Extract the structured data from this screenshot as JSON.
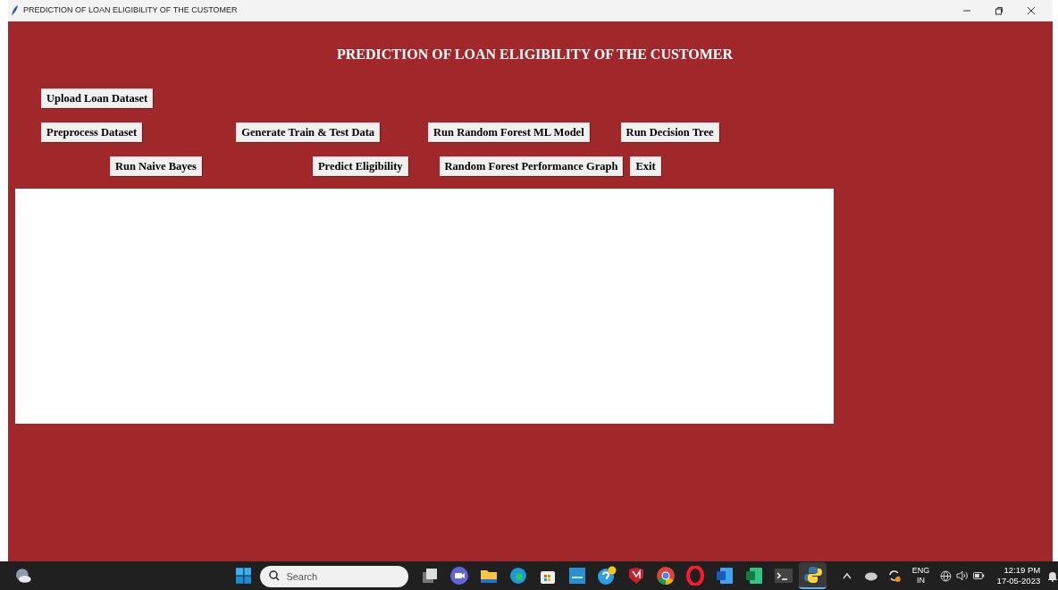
{
  "window": {
    "title": "PREDICTION OF LOAN ELIGIBILITY OF THE CUSTOMER"
  },
  "heading": "PREDICTION OF LOAN ELIGIBILITY OF THE CUSTOMER",
  "button_rows": [
    {
      "buttons": [
        {
          "label": "Upload Loan Dataset"
        }
      ]
    },
    {
      "buttons": [
        {
          "label": "Preprocess Dataset"
        },
        {
          "label": "Generate Train & Test Data"
        },
        {
          "label": "Run Random Forest ML Model"
        },
        {
          "label": "Run Decision Tree"
        }
      ]
    },
    {
      "buttons": [
        {
          "label": "Run Naive Bayes"
        },
        {
          "label": "Predict Eligibility"
        },
        {
          "label": "Random Forest Performance Graph"
        },
        {
          "label": "Exit"
        }
      ]
    }
  ],
  "taskbar": {
    "search": {
      "placeholder": "Search"
    },
    "apps": [
      {
        "kind": "taskview",
        "selected": false
      },
      {
        "kind": "meet",
        "selected": false
      },
      {
        "kind": "folder",
        "selected": false
      },
      {
        "kind": "edge",
        "selected": false
      },
      {
        "kind": "store",
        "selected": false
      },
      {
        "kind": "hp",
        "selected": false
      },
      {
        "kind": "help",
        "selected": false
      },
      {
        "kind": "shield",
        "selected": false
      },
      {
        "kind": "chrome",
        "selected": false
      },
      {
        "kind": "opera",
        "selected": false
      },
      {
        "kind": "word",
        "selected": false
      },
      {
        "kind": "excel",
        "selected": false
      },
      {
        "kind": "terminal",
        "selected": false
      },
      {
        "kind": "python",
        "selected": true
      }
    ],
    "language": [
      "ENG",
      "IN"
    ],
    "time": "12:19 PM",
    "date": "17-05-2023"
  }
}
